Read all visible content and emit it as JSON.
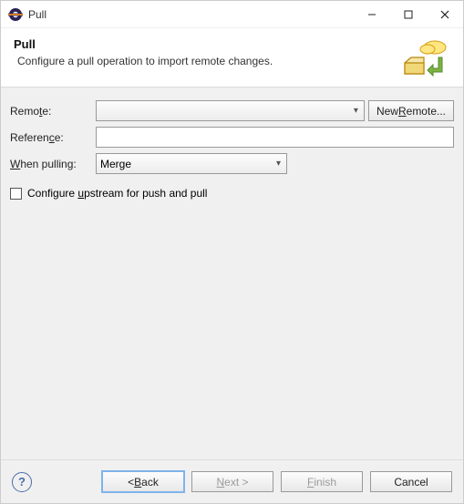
{
  "title": "Pull",
  "header": {
    "title": "Pull",
    "description": "Configure a pull operation to import remote changes."
  },
  "form": {
    "remote": {
      "label_pre": "Remo",
      "label_mn": "t",
      "label_post": "e:",
      "value": "",
      "new_remote_pre": "New ",
      "new_remote_mn": "R",
      "new_remote_post": "emote..."
    },
    "reference": {
      "label_pre": "Referen",
      "label_mn": "c",
      "label_post": "e:",
      "value": ""
    },
    "when_pulling": {
      "label_pre": "",
      "label_mn": "W",
      "label_post": "hen pulling:",
      "value": "Merge"
    },
    "upstream": {
      "label_pre": "Configure ",
      "label_mn": "u",
      "label_post": "pstream for push and pull",
      "checked": false
    }
  },
  "buttons": {
    "back_pre": "< ",
    "back_mn": "B",
    "back_post": "ack",
    "next_pre": "",
    "next_mn": "N",
    "next_post": "ext >",
    "finish_pre": "",
    "finish_mn": "F",
    "finish_post": "inish",
    "cancel": "Cancel"
  }
}
